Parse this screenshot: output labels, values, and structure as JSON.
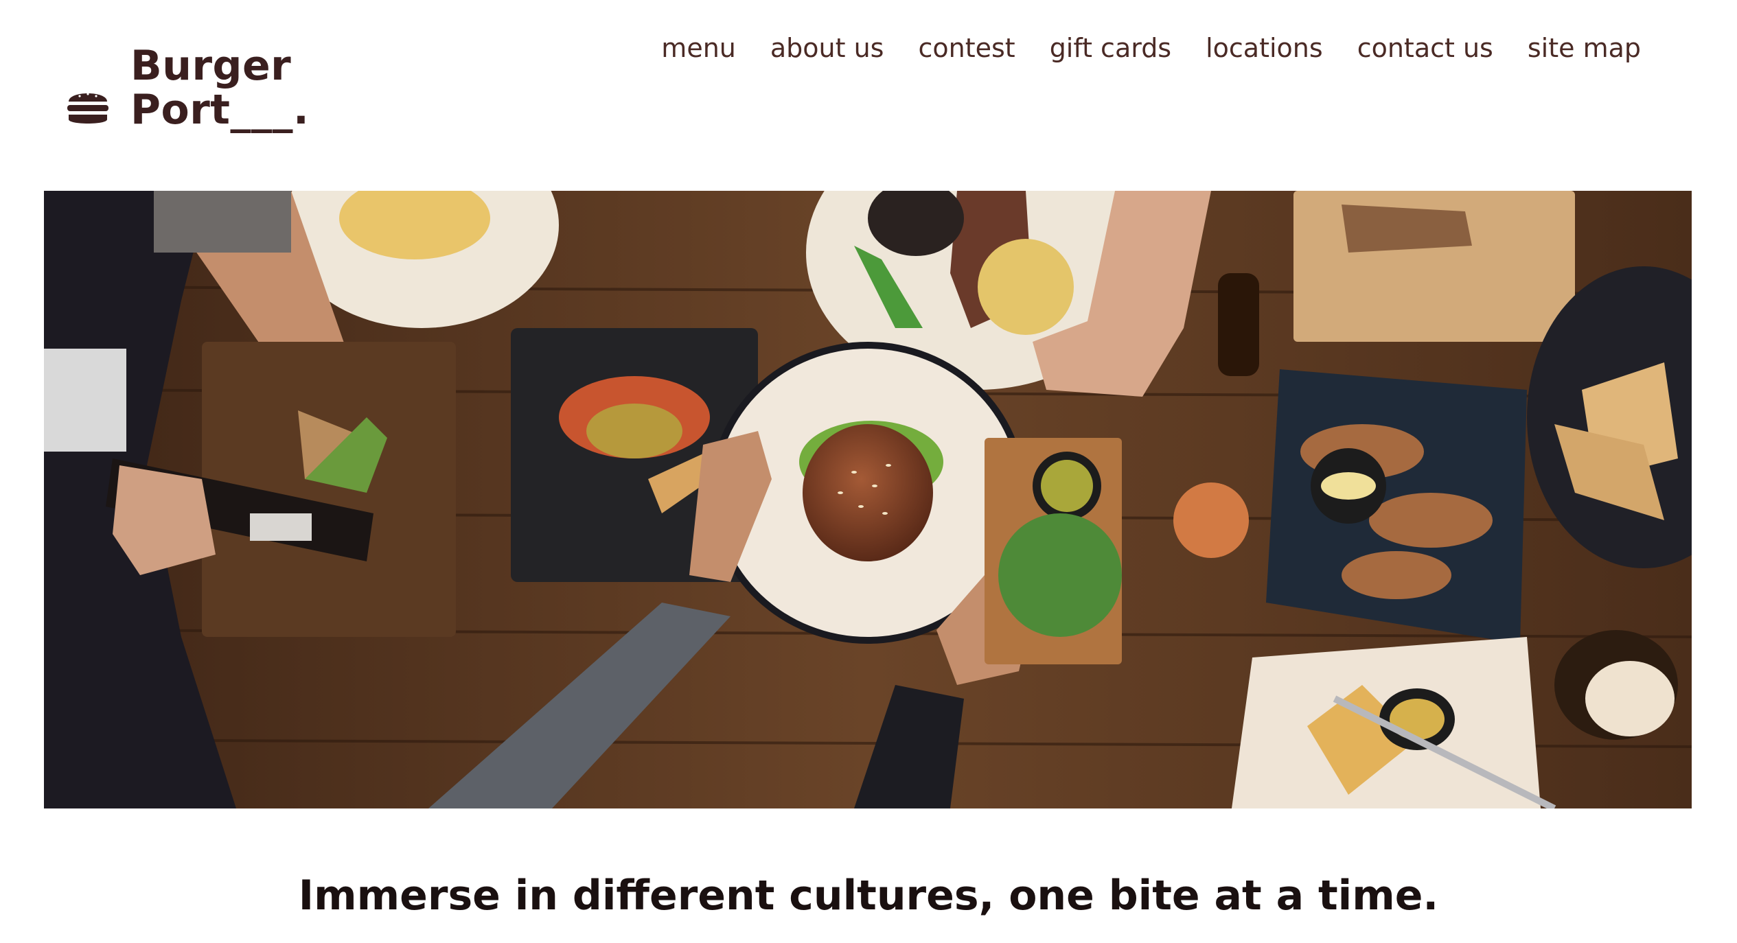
{
  "logo": {
    "line1": "Burger",
    "line2": "Port___.",
    "icon": "burger-icon"
  },
  "nav": {
    "items": [
      {
        "label": "menu"
      },
      {
        "label": "about us"
      },
      {
        "label": "contest"
      },
      {
        "label": "gift cards"
      },
      {
        "label": "locations"
      },
      {
        "label": "contact us"
      },
      {
        "label": "site map"
      }
    ]
  },
  "hero": {
    "description_hidden": true
  },
  "tagline": "Immerse in different cultures, one bite at a time.",
  "colors": {
    "brand": "#3a1f1f",
    "nav": "#4a2a25",
    "table_wood": "#5a3a24"
  }
}
